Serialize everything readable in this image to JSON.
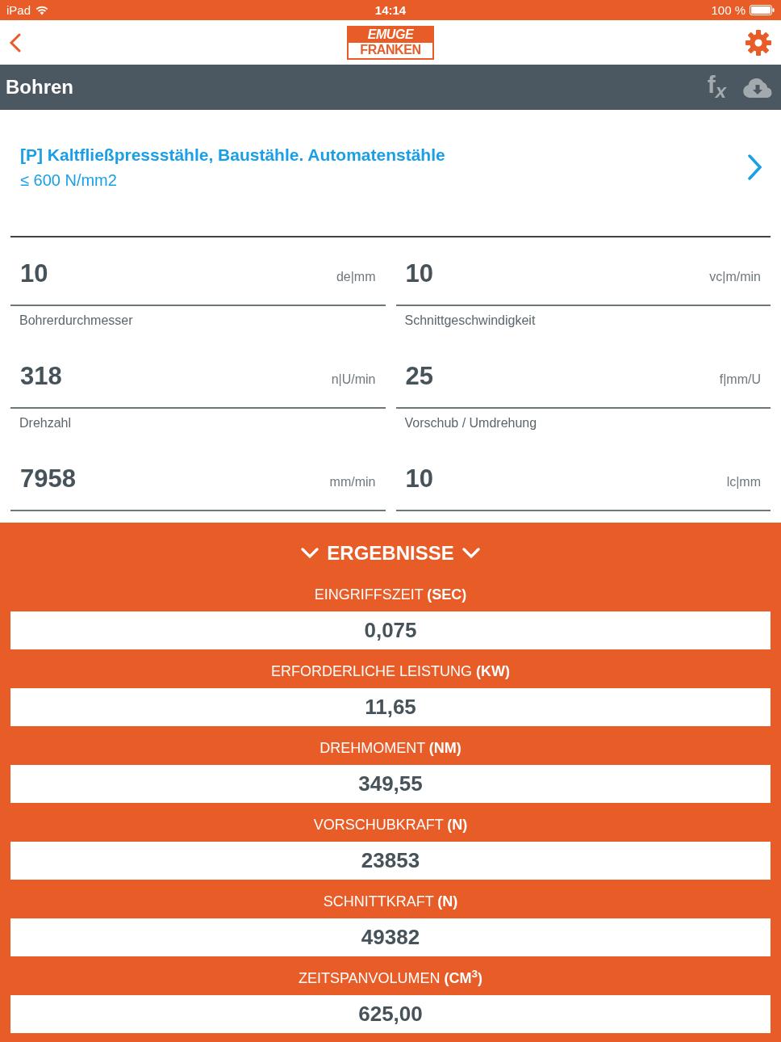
{
  "status_bar": {
    "device": "iPad",
    "time": "14:14",
    "battery": "100 %"
  },
  "nav_bar": {
    "logo": [
      "EMUGE",
      "FRANKEN"
    ]
  },
  "title_bar": {
    "title": "Bohren",
    "formula_button": "f$_{x}$"
  },
  "material": {
    "name": "[P] Kaltfließpressstähle, Baustähle. Automatenstähle",
    "strength": "≤ 600 N/mm2"
  },
  "fields": [
    {
      "value": "10",
      "unit": "de|mm",
      "label": "Bohrerdurchmesser"
    },
    {
      "value": "10",
      "unit": "vc|m/min",
      "label": "Schnittgeschwindigkeit"
    },
    {
      "value": "318",
      "unit": "n|U/min",
      "label": "Drehzahl"
    },
    {
      "value": "25",
      "unit": "f|mm/U",
      "label": "Vorschub / Umdrehung"
    },
    {
      "value": "7958",
      "unit": "mm/min"
    },
    {
      "value": "10",
      "unit": "lc|mm"
    }
  ],
  "results": {
    "title": "ERGEBNISSE",
    "expanded": true,
    "items": [
      {
        "label": "EINGRIFFSZEIT **(SEC)**",
        "value": "0,075"
      },
      {
        "label": "ERFORDERLICHE LEISTUNG **(KW)**",
        "value": "11,65"
      },
      {
        "label": "DREHMOMENT **(NM)**",
        "value": "349,55"
      },
      {
        "label": "VORSCHUBKRAFT **(N)**",
        "value": "23853"
      },
      {
        "label": "SCHNITTKRAFT **(N)**",
        "value": "49382"
      },
      {
        "label": "ZEITSPANVOLUMEN **(CM$^{3}$)**",
        "value": "625,00"
      }
    ]
  }
}
